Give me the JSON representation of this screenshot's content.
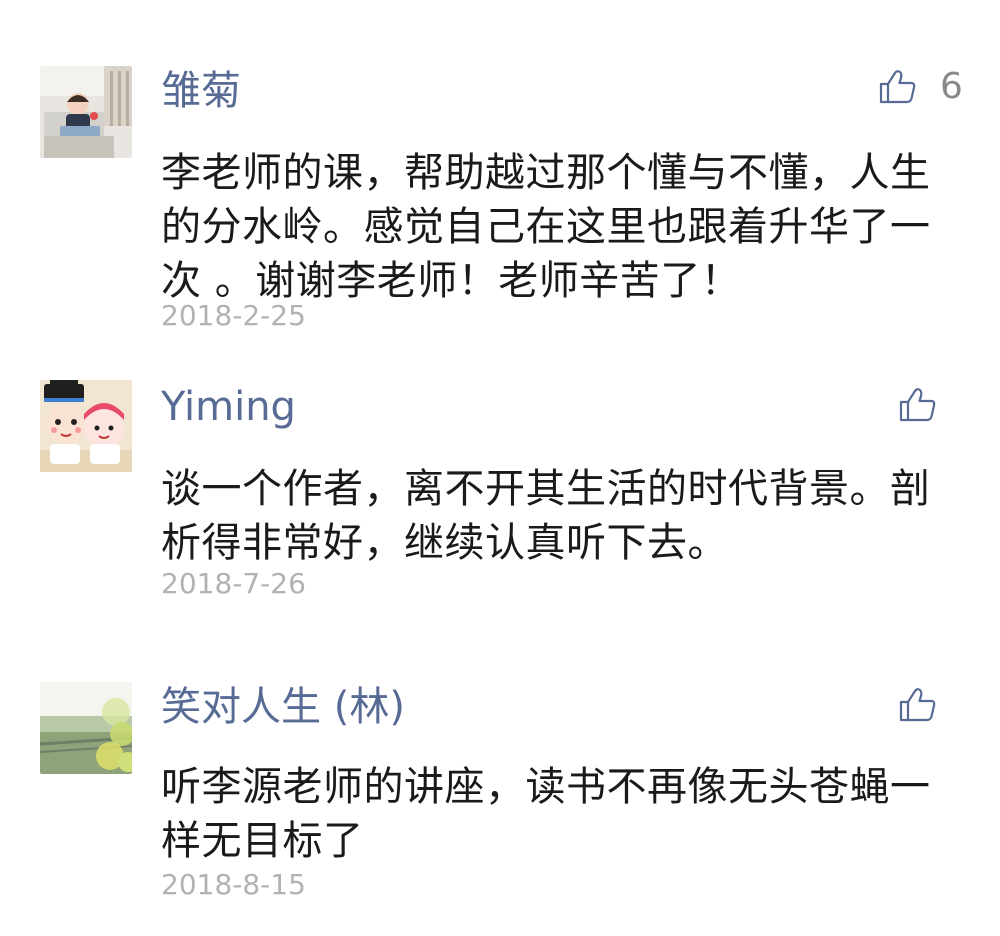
{
  "comments": [
    {
      "author": "雏菊",
      "text": "李老师的课，帮助越过那个懂与不懂，人生的分水岭。感觉自己在这里也跟着升华了一次 。谢谢李老师！老师辛苦了！",
      "date": "2018-2-25",
      "likes": "6",
      "like_icon": "thumbs-up-icon"
    },
    {
      "author": "Yiming",
      "text": "谈一个作者，离不开其生活的时代背景。剖析得非常好，继续认真听下去。",
      "date": "2018-7-26",
      "likes": "",
      "like_icon": "thumbs-up-icon"
    },
    {
      "author": "笑对人生 (林)",
      "text": "听李源老师的讲座，读书不再像无头苍蝇一样无目标了",
      "date": "2018-8-15",
      "likes": "",
      "like_icon": "thumbs-up-icon"
    }
  ],
  "colors": {
    "author": "#576b95",
    "text": "#1a1a1a",
    "date": "#b2b2b2",
    "like_icon": "#576b95"
  }
}
